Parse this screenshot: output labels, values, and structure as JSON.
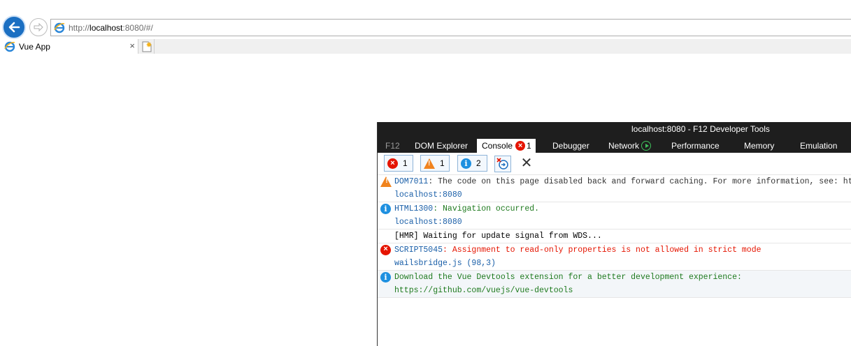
{
  "browser": {
    "url_prefix": "http://",
    "url_host": "localhost",
    "url_rest": ":8080/#/",
    "tab_title": "Vue App",
    "tab_close": "×"
  },
  "devtools": {
    "title": "localhost:8080 - F12 Developer Tools",
    "tabs": {
      "f12": "F12",
      "dom_explorer": "DOM Explorer",
      "console": "Console",
      "console_error_count": "1",
      "debugger": "Debugger",
      "network": "Network",
      "performance": "Performance",
      "memory": "Memory",
      "emulation": "Emulation"
    },
    "toolbar": {
      "errors_count": "1",
      "warnings_count": "1",
      "info_count": "2",
      "close_glyph": "✕"
    },
    "messages": [
      {
        "type": "warning",
        "code": "DOM7011",
        "text": ": The code on this page disabled back and forward caching. For more information, see: http:/",
        "source": "localhost:8080"
      },
      {
        "type": "info",
        "code": "HTML1300",
        "text": ": Navigation occurred.",
        "source": "localhost:8080"
      },
      {
        "type": "log",
        "text": "[HMR] Waiting for update signal from WDS..."
      },
      {
        "type": "error",
        "code": "SCRIPT5045",
        "text": ": Assignment to read-only properties is not allowed in strict mode",
        "source": "wailsbridge.js (98,3)"
      },
      {
        "type": "info",
        "text": "Download the Vue Devtools extension for a better development experience:",
        "text2": "https://github.com/vuejs/vue-devtools"
      }
    ]
  },
  "colors": {
    "error": "#e51400",
    "warning": "#f0831e",
    "info": "#1e90e0",
    "link": "#1a5fa8",
    "log_green": "#1e7a1e"
  }
}
